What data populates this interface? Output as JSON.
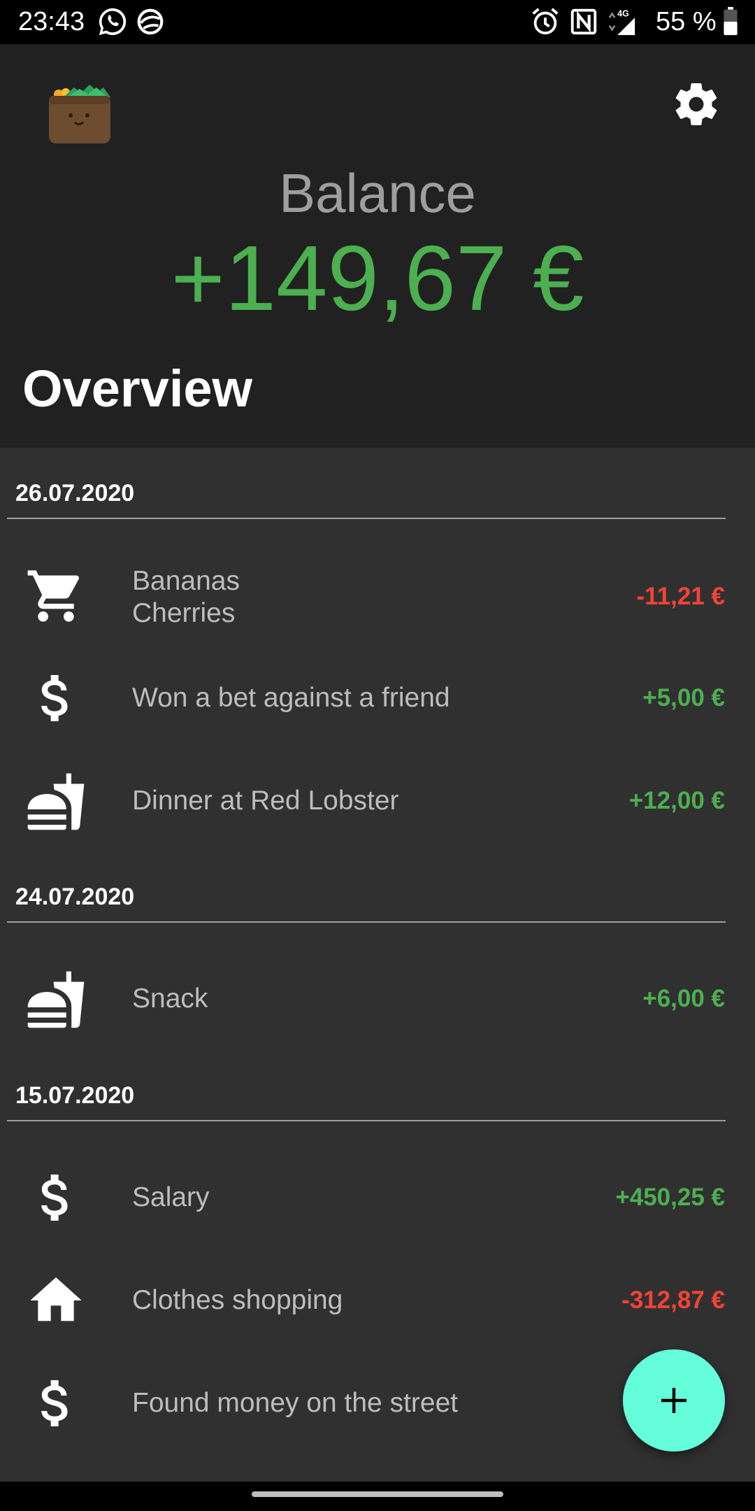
{
  "status_bar": {
    "time": "23:43",
    "battery_text": "55 %",
    "icons": [
      "whatsapp-icon",
      "chat-icon",
      "alarm-icon",
      "nfc-icon",
      "signal-4g-icon",
      "battery-icon"
    ]
  },
  "header": {
    "logo_icon": "wallet-icon",
    "settings_icon": "gear-icon",
    "balance_label": "Balance",
    "balance_value": "+149,67 €",
    "overview_title": "Overview"
  },
  "colors": {
    "positive": "#4caf50",
    "negative": "#f44336",
    "fab": "#64ffda"
  },
  "groups": [
    {
      "date": "26.07.2020",
      "transactions": [
        {
          "icon": "shopping-cart-icon",
          "line1": "Bananas",
          "line2": "Cherries",
          "amount": "-11,21 €",
          "sign": "neg"
        },
        {
          "icon": "dollar-icon",
          "line1": "Won a bet against a friend",
          "amount": "+5,00 €",
          "sign": "pos"
        },
        {
          "icon": "fastfood-icon",
          "line1": "Dinner at Red Lobster",
          "amount": "+12,00 €",
          "sign": "pos"
        }
      ]
    },
    {
      "date": "24.07.2020",
      "transactions": [
        {
          "icon": "fastfood-icon",
          "line1": "Snack",
          "amount": "+6,00 €",
          "sign": "pos"
        }
      ]
    },
    {
      "date": "15.07.2020",
      "transactions": [
        {
          "icon": "dollar-icon",
          "line1": "Salary",
          "amount": "+450,25 €",
          "sign": "pos"
        },
        {
          "icon": "home-icon",
          "line1": "Clothes shopping",
          "amount": "-312,87 €",
          "sign": "neg"
        },
        {
          "icon": "dollar-icon",
          "line1": "Found money on the street",
          "amount": "",
          "sign": "pos"
        }
      ]
    }
  ],
  "fab": {
    "icon": "plus-icon"
  }
}
